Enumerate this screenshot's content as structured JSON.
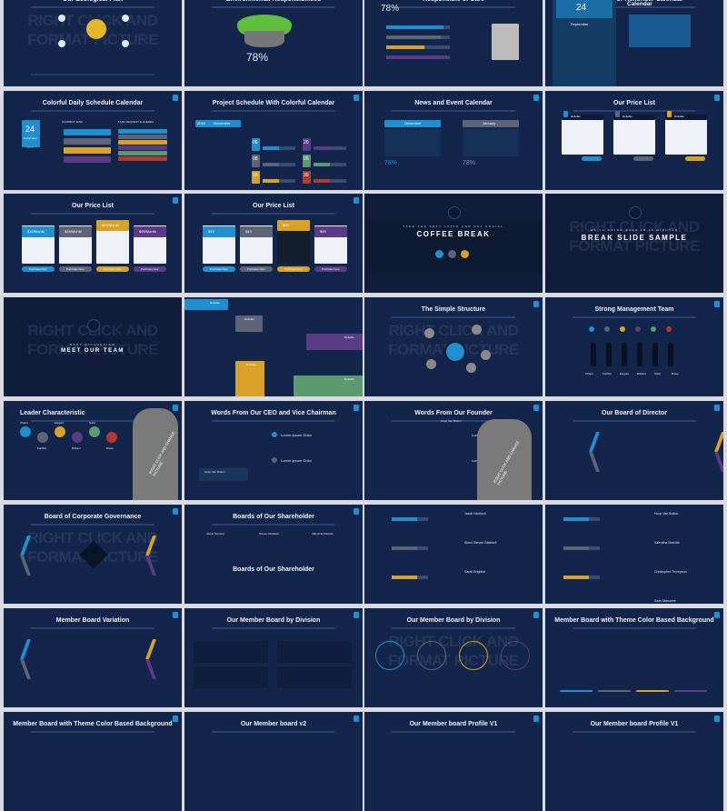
{
  "colors": {
    "blue": "#1f8fd0",
    "gray": "#5d6478",
    "gold": "#d7a227",
    "purple": "#5b3a86",
    "green": "#5a9a6e",
    "red": "#b33a2c",
    "navy": "#13254a"
  },
  "watermark": "RIGHT CLICK AND FORMAT PICTURE",
  "slides": [
    {
      "title": "Our Ecological Plan",
      "kind": "eco",
      "watermark": true
    },
    {
      "title": "Environmental Responsibilities",
      "kind": "island",
      "big": "78%"
    },
    {
      "title": "Responsible of Care",
      "kind": "bars",
      "big": "78%"
    },
    {
      "title": "Single Color Reminder Calendar",
      "kind": "reminder",
      "day": "24",
      "month": "September"
    },
    {
      "title": "Colorful Daily Schedule Calendar",
      "kind": "daily",
      "day": "24",
      "month": "September",
      "year": "2015",
      "labels": [
        "CURRENT TASK",
        "TASK REQUEST & AGENDA"
      ]
    },
    {
      "title": "Project Schedule With Colorful Calendar",
      "kind": "project",
      "year": "2015",
      "month": "November",
      "numbers": [
        "06",
        "20",
        "08",
        "26",
        "16",
        "30"
      ]
    },
    {
      "title": "News and Event Calendar",
      "kind": "news",
      "months": [
        "December",
        "January"
      ],
      "big": "78%"
    },
    {
      "title": "Our Price List",
      "kind": "price3",
      "plans": [
        "Reliable",
        "Reliable",
        "Reliable"
      ]
    },
    {
      "title": "Our Price List",
      "kind": "price4",
      "prices": [
        "$19/Month",
        "$49/Month",
        "$69/Month",
        "$99/Month"
      ],
      "button": "Purchase Now"
    },
    {
      "title": "Our Price List",
      "kind": "price4b",
      "prices": [
        "$19",
        "$49",
        "$69",
        "$99"
      ],
      "button": "Purchase Now"
    },
    {
      "title": "",
      "kind": "coffee",
      "tag": "TAKE THE SOFT LATTE AND GET SOCIAL",
      "caption": "COFFEE BREAK",
      "watermark": true
    },
    {
      "title": "",
      "kind": "break",
      "tag": "WE'LL GOING BACK IN 10 MINUTES",
      "caption": "BREAK SLIDE SAMPLE",
      "watermark": true
    },
    {
      "title": "",
      "kind": "team",
      "tag": "NEXT DISCUSSION",
      "caption": "MEET OUR TEAM",
      "watermark": true
    },
    {
      "title": "",
      "kind": "tiles",
      "labels": [
        "Reliable",
        "Reliable",
        "Reliable",
        "Reliable",
        "Reliable"
      ]
    },
    {
      "title": "The Simple Structure",
      "kind": "structure",
      "watermark": true
    },
    {
      "title": "Strong Management Team",
      "kind": "mgmt",
      "names": [
        "Charm",
        "Faithful",
        "Elegant",
        "Brilliant",
        "Solid",
        "Brave"
      ]
    },
    {
      "title": "Leader Characteristic",
      "kind": "leader",
      "left": true,
      "names": [
        "Charm",
        "Faithful",
        "Elegant",
        "Brilliant",
        "Solid",
        "Brave"
      ],
      "photo": "RIGHT CLICK AND CHANGE PICTURE"
    },
    {
      "title": "Words From Our CEO and Vice Chairman",
      "kind": "ceo",
      "items": [
        "Lorem Ipsum Dolor",
        "Lorem Ipsum Dolor"
      ],
      "name": "Hoop Van Button"
    },
    {
      "title": "Words From Our Founder",
      "kind": "founder",
      "items": [
        "Lorem Ipsum Dolor",
        "Lorem Ipsum Dolor"
      ],
      "name": "Hoop Van Button",
      "photo": "RIGHT CLICK AND CHANGE PICTURE"
    },
    {
      "title": "Our Board of Director",
      "kind": "director"
    },
    {
      "title": "Board of Corporate Governance",
      "kind": "governance",
      "watermark": true
    },
    {
      "title": "Boards of Our Shareholder",
      "kind": "shareholder",
      "names": [
        "Jacob Nicolson",
        "Steven Gladwell",
        "Valentina Marlotte"
      ]
    },
    {
      "title": "",
      "kind": "abilities",
      "names": [
        "Jacob Nicolson",
        "About Steven Gladwell",
        "Sarah Brighton"
      ]
    },
    {
      "title": "",
      "kind": "percent",
      "names": [
        "Hoop Van Button",
        "Valentina Marlotte",
        "Christopher Thompson",
        "Sean Marsame"
      ]
    },
    {
      "title": "Member Board Variation",
      "kind": "variation"
    },
    {
      "title": "Our Member Board by Division",
      "kind": "division"
    },
    {
      "title": "Our Member Board by Division",
      "kind": "circles",
      "watermark": true
    },
    {
      "title": "Member Board with Theme Color Based Background",
      "kind": "theme"
    },
    {
      "title": "Member Board with Theme Color Based Background",
      "kind": "plain"
    },
    {
      "title": "Our Member board v2",
      "kind": "plain"
    },
    {
      "title": "Our Member board Profile V1",
      "kind": "plain"
    },
    {
      "title": "Our Member board Profile V1",
      "kind": "plain"
    }
  ]
}
